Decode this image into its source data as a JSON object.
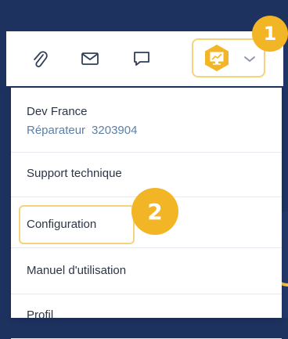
{
  "toolbar": {
    "icons": [
      "paperclip-icon",
      "mail-icon",
      "chat-icon"
    ],
    "avatar_icon": "monitor-chart-icon",
    "chevron_icon": "chevron-down-icon"
  },
  "badges": {
    "one": "1",
    "two": "2"
  },
  "user": {
    "name": "Dev France",
    "role": "Réparateur",
    "id": "3203904"
  },
  "menu": {
    "items": [
      {
        "label": "Support technique"
      },
      {
        "label": "Configuration"
      },
      {
        "label": "Manuel d'utilisation"
      },
      {
        "label": "Profil"
      }
    ]
  },
  "colors": {
    "background": "#1e3260",
    "accent": "#f2b526",
    "highlight": "#f5d37b",
    "text": "#2c3547",
    "role_text": "#5b7fa8"
  }
}
